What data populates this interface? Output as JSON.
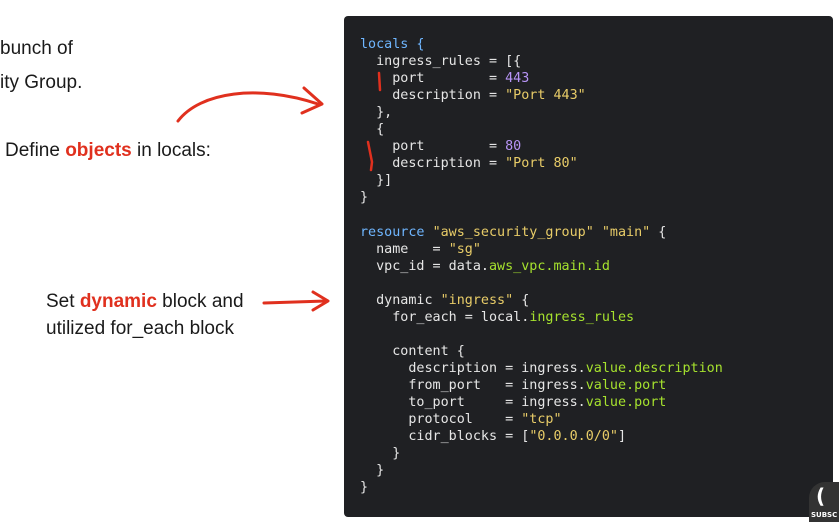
{
  "slide": {
    "line1": "bunch of",
    "line2": "ity Group.",
    "objects_prefix": "Define ",
    "objects_word": "objects",
    "objects_suffix": " in locals:",
    "dynamic_prefix": "Set ",
    "dynamic_word": "dynamic",
    "dynamic_suffix": " block and",
    "dynamic_line2": "utilized for_each block"
  },
  "code": {
    "l1": "locals {",
    "l2": "  ingress_rules = [{",
    "l3": "    port        = ",
    "l3v": "443",
    "l4": "    description = ",
    "l4v": "\"Port 443\"",
    "l5": "  },",
    "l6": "  {",
    "l7": "    port        = ",
    "l7v": "80",
    "l8": "    description = ",
    "l8v": "\"Port 80\"",
    "l9": "  }]",
    "l10": "}",
    "l11": "",
    "l12a": "resource ",
    "l12b": "\"aws_security_group\"",
    "l12c": " ",
    "l12d": "\"main\"",
    "l12e": " {",
    "l13": "  name   = ",
    "l13v": "\"sg\"",
    "l14": "  vpc_id = data.",
    "l14v": "aws_vpc.main.id",
    "l15": "",
    "l16": "  dynamic ",
    "l16v": "\"ingress\"",
    "l16e": " {",
    "l17": "    for_each = local.",
    "l17v": "ingress_rules",
    "l18": "",
    "l19": "    content {",
    "l20": "      description = ingress.",
    "l20v": "value.description",
    "l21": "      from_port   = ingress.",
    "l21v": "value.port",
    "l22": "      to_port     = ingress.",
    "l22v": "value.port",
    "l23": "      protocol    = ",
    "l23v": "\"tcp\"",
    "l24": "      cidr_blocks = [",
    "l24v": "\"0.0.0.0/0\"",
    "l24e": "]",
    "l25": "    }",
    "l26": "  }",
    "l27": "}"
  },
  "badge": {
    "glyph": "(",
    "text": "SUBSC"
  },
  "colors": {
    "highlight": "#e0301e",
    "code_bg": "#1f2023",
    "keyword": "#6fb6ff",
    "string": "#e8cc68",
    "number": "#b794f6",
    "attribute": "#a6e22e"
  }
}
